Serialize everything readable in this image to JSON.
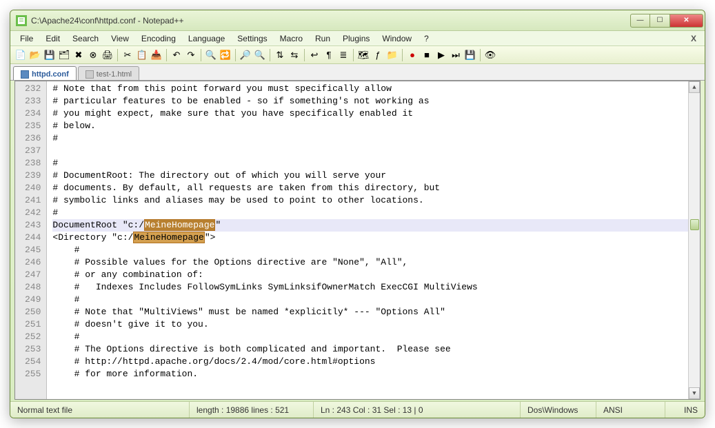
{
  "window": {
    "title": "C:\\Apache24\\conf\\httpd.conf - Notepad++"
  },
  "menu": {
    "items": [
      "File",
      "Edit",
      "Search",
      "View",
      "Encoding",
      "Language",
      "Settings",
      "Macro",
      "Run",
      "Plugins",
      "Window",
      "?"
    ]
  },
  "tabs": [
    {
      "label": "httpd.conf",
      "active": true
    },
    {
      "label": "test-1.html",
      "active": false
    }
  ],
  "editor": {
    "first_line": 232,
    "current_line_index": 11,
    "lines": [
      "# Note that from this point forward you must specifically allow",
      "# particular features to be enabled - so if something's not working as",
      "# you might expect, make sure that you have specifically enabled it",
      "# below.",
      "#",
      "",
      "#",
      "# DocumentRoot: The directory out of which you will serve your",
      "# documents. By default, all requests are taken from this directory, but",
      "# symbolic links and aliases may be used to point to other locations.",
      "#",
      {
        "pre": "DocumentRoot \"c:/",
        "hl": "MeineHomepage",
        "post": "\"",
        "selected": true
      },
      {
        "pre": "<Directory \"c:/",
        "hl": "MeineHomepage",
        "post": "\">",
        "selected": false
      },
      "    #",
      "    # Possible values for the Options directive are \"None\", \"All\",",
      "    # or any combination of:",
      "    #   Indexes Includes FollowSymLinks SymLinksifOwnerMatch ExecCGI MultiViews",
      "    #",
      "    # Note that \"MultiViews\" must be named *explicitly* --- \"Options All\"",
      "    # doesn't give it to you.",
      "    #",
      "    # The Options directive is both complicated and important.  Please see",
      "    # http://httpd.apache.org/docs/2.4/mod/core.html#options",
      "    # for more information."
    ]
  },
  "status": {
    "type": "Normal text file",
    "length": "length : 19886    lines : 521",
    "pos": "Ln : 243    Col : 31    Sel : 13 | 0",
    "eol": "Dos\\Windows",
    "enc": "ANSI",
    "mode": "INS"
  },
  "glyphs": {
    "min": "—",
    "max": "☐",
    "close": "✕",
    "scroll_up": "▲",
    "scroll_down": "▼"
  }
}
